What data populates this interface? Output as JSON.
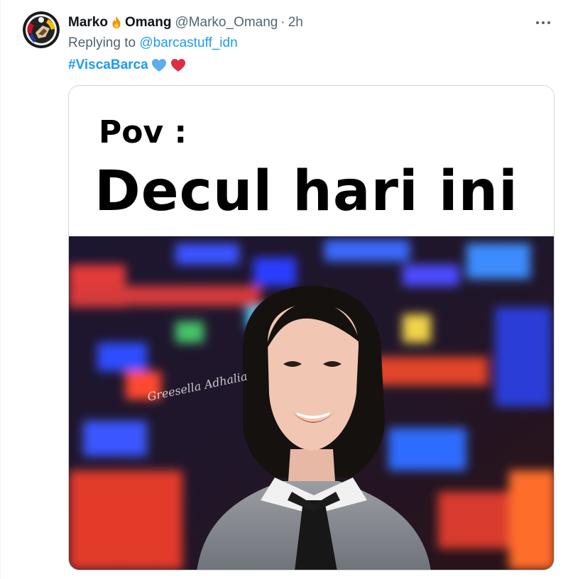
{
  "tweet": {
    "author_name_part1": "Marko",
    "author_name_part2": "Omang",
    "handle": "@Marko_Omang",
    "separator": "·",
    "time": "2h",
    "replying_label": "Replying to",
    "replying_to": "@barcastuff_idn",
    "hashtag": "#ViscaBarca",
    "emojis": [
      "blue-heart-icon",
      "red-heart-icon"
    ]
  },
  "media": {
    "meme_line1": "Pov :",
    "meme_line2": "Decul hari ini",
    "watermark_text": "Greesella Adhalia"
  },
  "colors": {
    "link": "#1d9bf0",
    "secondary_text": "#536471",
    "border": "#cfd9de"
  }
}
